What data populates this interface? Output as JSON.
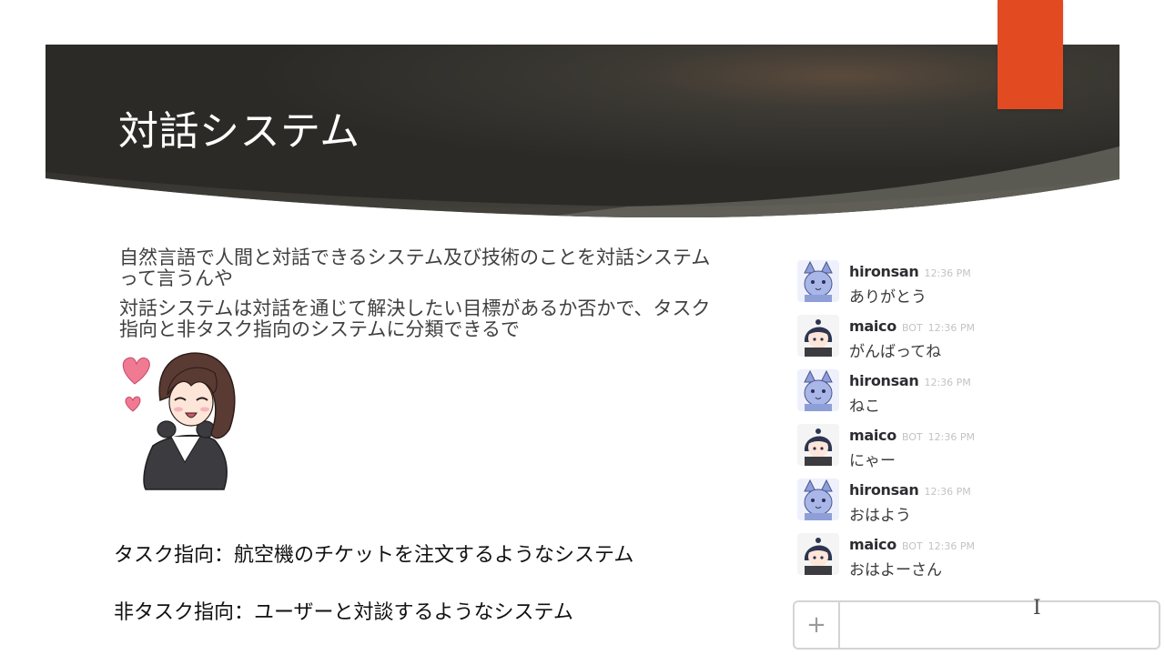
{
  "slide": {
    "title": "対話システム",
    "paragraph1": "自然言語で人間と対話できるシステム及び技術のことを対話システムって言うんや",
    "paragraph2": "対話システムは対話を通じて解決したい目標があるか否かで、タスク指向と非タスク指向のシステムに分類できるで",
    "definition_task": "タスク指向：航空機のチケットを注文するようなシステム",
    "definition_nontask": "非タスク指向：ユーザーと対談するようなシステム"
  },
  "colors": {
    "banner_dark": "#2f2d29",
    "banner_light": "#4a4740",
    "accent": "#e24b22",
    "heart": "#f07a92"
  },
  "chat": {
    "messages": [
      {
        "user": "hironsan",
        "bot": "",
        "time": "12:36 PM",
        "text": "ありがとう",
        "avatar": "cat-avatar-icon"
      },
      {
        "user": "maico",
        "bot": "BOT",
        "time": "12:36 PM",
        "text": "がんばってね",
        "avatar": "girl-avatar-icon"
      },
      {
        "user": "hironsan",
        "bot": "",
        "time": "12:36 PM",
        "text": "ねこ",
        "avatar": "cat-avatar-icon"
      },
      {
        "user": "maico",
        "bot": "BOT",
        "time": "12:36 PM",
        "text": "にゃー",
        "avatar": "girl-avatar-icon"
      },
      {
        "user": "hironsan",
        "bot": "",
        "time": "12:36 PM",
        "text": "おはよう",
        "avatar": "cat-avatar-icon"
      },
      {
        "user": "maico",
        "bot": "BOT",
        "time": "12:36 PM",
        "text": "おはよーさん",
        "avatar": "girl-avatar-icon"
      }
    ],
    "composer_plus": "+",
    "text_cursor": "I"
  }
}
